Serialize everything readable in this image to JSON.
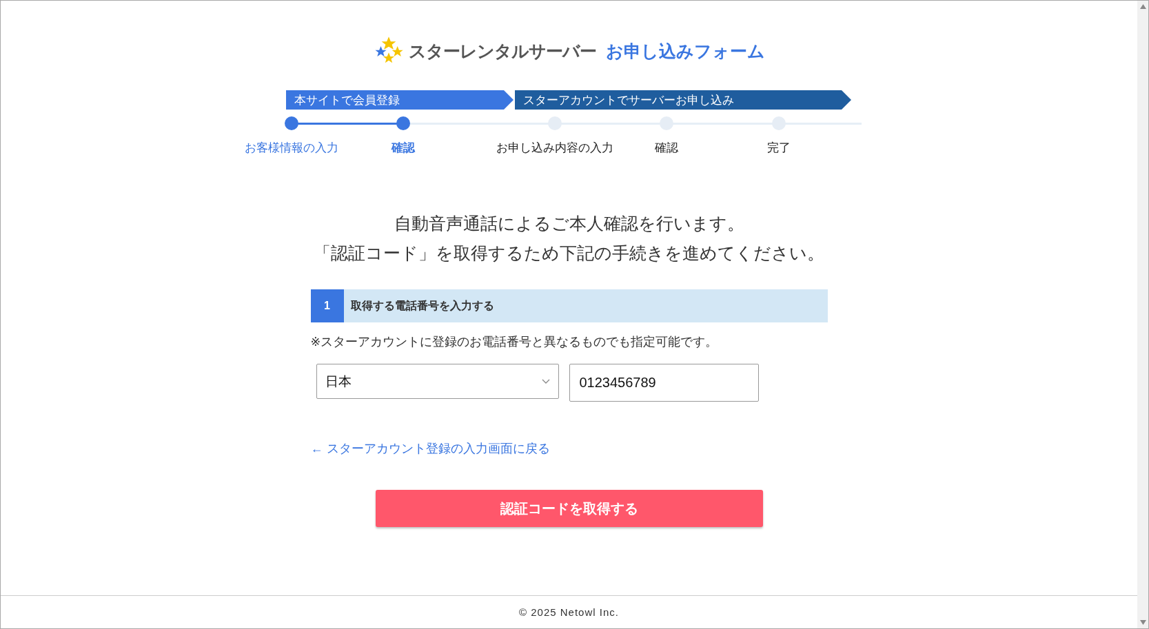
{
  "logo": {
    "brand": "スターレンタルサーバー",
    "title": "お申し込みフォーム"
  },
  "phases": [
    {
      "label": "本サイトで会員登録",
      "color": "#3a76e0"
    },
    {
      "label": "スターアカウントでサーバーお申し込み",
      "color": "#1f5d9e"
    }
  ],
  "steps": [
    {
      "label": "お客様情報の入力",
      "completed": true,
      "selected": false
    },
    {
      "label": "確認",
      "completed": true,
      "selected": true
    },
    {
      "label": "お申し込み内容の入力",
      "completed": false,
      "selected": false
    },
    {
      "label": "確認",
      "completed": false,
      "selected": false
    },
    {
      "label": "完了",
      "completed": false,
      "selected": false
    }
  ],
  "intro": [
    "自動音声通話によるご本人確認を行います。",
    "「認証コード」を取得するため下記の手続きを進めてください。"
  ],
  "section": {
    "number": "1",
    "title": "取得する電話番号を入力する",
    "note": "※スターアカウントに登録のお電話番号と異なるものでも指定可能です。",
    "country": "日本",
    "phone": "0123456789"
  },
  "back_link": "← スターアカウント登録の入力画面に戻る",
  "submit": "認証コードを取得する",
  "footer": "© 2025 Netowl Inc."
}
